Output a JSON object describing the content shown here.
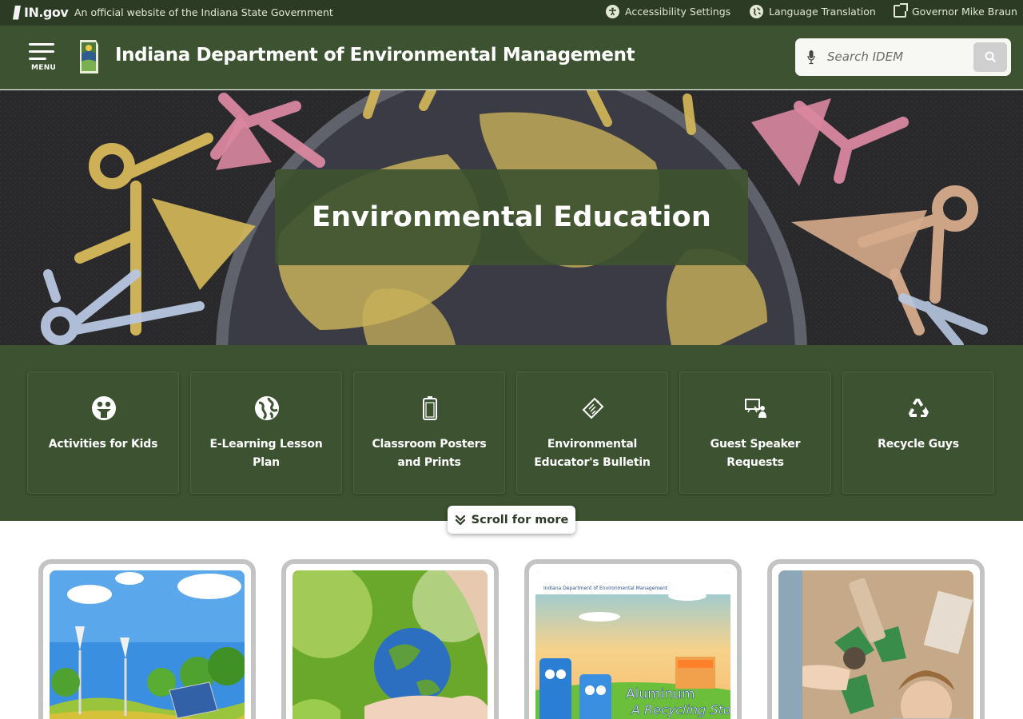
{
  "topbar": {
    "brand": "IN.gov",
    "official_text": "An official website of the Indiana State Government",
    "links": [
      {
        "label": "Accessibility Settings",
        "icon": "accessibility-icon"
      },
      {
        "label": "Language Translation",
        "icon": "globe-icon"
      },
      {
        "label": "Governor Mike Braun",
        "icon": "external-link-icon"
      }
    ]
  },
  "header": {
    "menu_label": "MENU",
    "title": "Indiana Department of Environmental Management",
    "search": {
      "placeholder": "Search IDEM"
    }
  },
  "hero": {
    "title": "Environmental Education"
  },
  "quick_links": [
    {
      "label": "Activities for Kids",
      "icon": "kids-icon"
    },
    {
      "label": "E-Learning Lesson Plan",
      "icon": "globe-icon"
    },
    {
      "label": "Classroom Posters and Prints",
      "icon": "poster-icon"
    },
    {
      "label": "Environmental Educator's Bulletin",
      "icon": "bulletin-icon"
    },
    {
      "label": "Guest Speaker Requests",
      "icon": "speaker-icon"
    },
    {
      "label": "Recycle Guys",
      "icon": "recycle-icon"
    }
  ],
  "scroll_more": "Scroll for more",
  "cards": [
    {
      "image": "wind-turbines-solar-panel"
    },
    {
      "image": "earth-in-hands"
    },
    {
      "image": "aluminum-recycling-story",
      "header_text": "Indiana Department of Environmental Management",
      "title_line1": "Aluminum",
      "title_line2": "A Recycling Stor"
    },
    {
      "image": "kids-recycling"
    }
  ],
  "colors": {
    "topbar_bg": "#2b3b24",
    "header_bg": "#3d5230",
    "accent_green": "#3d5230",
    "card_border": "#c4c4c4"
  }
}
